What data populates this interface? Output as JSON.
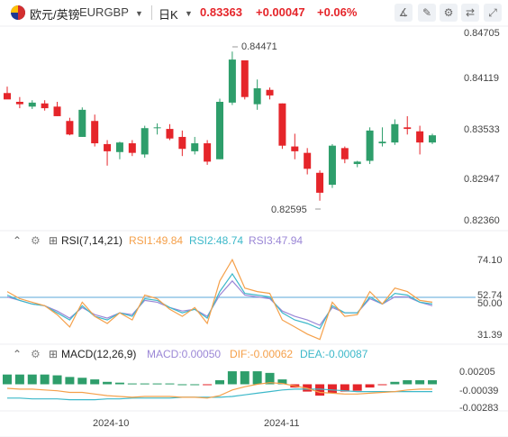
{
  "header": {
    "pair_name": "欧元/英镑",
    "symbol": "EURGBP",
    "period": "日K",
    "price": "0.83363",
    "change": "+0.00047",
    "change_pct": "+0.06%"
  },
  "price_axis": [
    "0.84705",
    "0.84119",
    "0.83533",
    "0.82947",
    "0.82360"
  ],
  "high_label": "0.84471",
  "low_label": "0.82595",
  "rsi": {
    "label": "RSI(7,14,21)",
    "rsi1": "RSI1:49.84",
    "rsi2": "RSI2:48.74",
    "rsi3": "RSI3:47.94",
    "axis": [
      "74.10",
      "52.74",
      "50.00",
      "31.39"
    ]
  },
  "macd": {
    "label": "MACD(12,26,9)",
    "macd": "MACD:0.00050",
    "dif": "DIF:-0.00062",
    "dea": "DEA:-0.00087",
    "axis": [
      "0.00205",
      "-0.00039",
      "-0.00283"
    ]
  },
  "dates": [
    "2024-10",
    "2024-11"
  ],
  "colors": {
    "up": "#2e9e6b",
    "down": "#e5252a",
    "rsi1": "#f5a04a",
    "rsi2": "#3cb8c9",
    "rsi3": "#9b87d6"
  },
  "icons": [
    "chart-type-icon",
    "drawing-tools-icon",
    "indicator-icon",
    "compare-icon",
    "fullscreen-icon"
  ],
  "chart_data": {
    "type": "candlestick",
    "candles": [
      {
        "o": 0.8395,
        "h": 0.8403,
        "l": 0.8388,
        "c": 0.8387
      },
      {
        "o": 0.8384,
        "h": 0.839,
        "l": 0.8376,
        "c": 0.8381
      },
      {
        "o": 0.8378,
        "h": 0.8386,
        "l": 0.8375,
        "c": 0.8383
      },
      {
        "o": 0.8382,
        "h": 0.8386,
        "l": 0.8373,
        "c": 0.8376
      },
      {
        "o": 0.8378,
        "h": 0.8384,
        "l": 0.8366,
        "c": 0.8366
      },
      {
        "o": 0.836,
        "h": 0.8364,
        "l": 0.8342,
        "c": 0.8343
      },
      {
        "o": 0.834,
        "h": 0.8377,
        "l": 0.834,
        "c": 0.8374
      },
      {
        "o": 0.836,
        "h": 0.8368,
        "l": 0.8328,
        "c": 0.8332
      },
      {
        "o": 0.8331,
        "h": 0.8336,
        "l": 0.8304,
        "c": 0.8322
      },
      {
        "o": 0.8321,
        "h": 0.8334,
        "l": 0.8312,
        "c": 0.8333
      },
      {
        "o": 0.8332,
        "h": 0.8336,
        "l": 0.8316,
        "c": 0.832
      },
      {
        "o": 0.8318,
        "h": 0.8354,
        "l": 0.8314,
        "c": 0.8351
      },
      {
        "o": 0.8351,
        "h": 0.8357,
        "l": 0.8343,
        "c": 0.8352
      },
      {
        "o": 0.835,
        "h": 0.8356,
        "l": 0.8336,
        "c": 0.8338
      },
      {
        "o": 0.834,
        "h": 0.8348,
        "l": 0.8316,
        "c": 0.8325
      },
      {
        "o": 0.8322,
        "h": 0.834,
        "l": 0.8318,
        "c": 0.8332
      },
      {
        "o": 0.8332,
        "h": 0.8336,
        "l": 0.8305,
        "c": 0.8309
      },
      {
        "o": 0.8312,
        "h": 0.8388,
        "l": 0.8312,
        "c": 0.8384
      },
      {
        "o": 0.8383,
        "h": 0.8447,
        "l": 0.838,
        "c": 0.8437
      },
      {
        "o": 0.8436,
        "h": 0.8436,
        "l": 0.8387,
        "c": 0.839
      },
      {
        "o": 0.8381,
        "h": 0.8412,
        "l": 0.8374,
        "c": 0.8401
      },
      {
        "o": 0.8399,
        "h": 0.8402,
        "l": 0.8387,
        "c": 0.8392
      },
      {
        "o": 0.8382,
        "h": 0.8382,
        "l": 0.8325,
        "c": 0.8329
      },
      {
        "o": 0.8328,
        "h": 0.8344,
        "l": 0.8312,
        "c": 0.8322
      },
      {
        "o": 0.832,
        "h": 0.8326,
        "l": 0.8293,
        "c": 0.83
      },
      {
        "o": 0.8295,
        "h": 0.8298,
        "l": 0.826,
        "c": 0.827
      },
      {
        "o": 0.828,
        "h": 0.8331,
        "l": 0.8276,
        "c": 0.8329
      },
      {
        "o": 0.8326,
        "h": 0.8328,
        "l": 0.8307,
        "c": 0.8312
      },
      {
        "o": 0.8306,
        "h": 0.831,
        "l": 0.8302,
        "c": 0.8309
      },
      {
        "o": 0.831,
        "h": 0.8352,
        "l": 0.8306,
        "c": 0.8348
      },
      {
        "o": 0.8332,
        "h": 0.8352,
        "l": 0.8328,
        "c": 0.8334
      },
      {
        "o": 0.8333,
        "h": 0.8362,
        "l": 0.833,
        "c": 0.8356
      },
      {
        "o": 0.8352,
        "h": 0.8366,
        "l": 0.8343,
        "c": 0.835
      },
      {
        "o": 0.8347,
        "h": 0.8354,
        "l": 0.8318,
        "c": 0.8333
      },
      {
        "o": 0.8333,
        "h": 0.8344,
        "l": 0.8331,
        "c": 0.8342
      }
    ],
    "rsi1": [
      56,
      52,
      50,
      48,
      43,
      36,
      50,
      42,
      38,
      44,
      40,
      54,
      52,
      46,
      42,
      47,
      38,
      62,
      74,
      58,
      56,
      55,
      40,
      36,
      32,
      29,
      50,
      42,
      43,
      56,
      49,
      58,
      56,
      51,
      50
    ],
    "rsi2": [
      54,
      51,
      49,
      48,
      44,
      40,
      48,
      42,
      40,
      44,
      42,
      52,
      51,
      47,
      44,
      46,
      41,
      56,
      66,
      55,
      54,
      53,
      44,
      40,
      38,
      35,
      48,
      44,
      44,
      53,
      49,
      55,
      54,
      50,
      49
    ],
    "rsi3": [
      53,
      51,
      49,
      48,
      45,
      41,
      47,
      43,
      41,
      44,
      43,
      51,
      50,
      47,
      45,
      46,
      42,
      54,
      62,
      54,
      53,
      52,
      45,
      42,
      40,
      37,
      47,
      44,
      44,
      52,
      49,
      53,
      53,
      50,
      48
    ],
    "macd_hist": [
      0.0012,
      0.0012,
      0.0012,
      0.0012,
      0.0011,
      0.0009,
      0.0008,
      0.0006,
      0.0003,
      0.0002,
      0.0001,
      0.0001,
      0.0001,
      0.0001,
      0.0,
      0.0,
      -0.0001,
      0.0005,
      0.0016,
      0.0016,
      0.0016,
      0.0014,
      0.0006,
      -0.0004,
      -0.0009,
      -0.0014,
      -0.0011,
      -0.0009,
      -0.0008,
      -0.0004,
      -0.0001,
      0.0003,
      0.0005,
      0.0005,
      0.0005
    ],
    "dif": [
      -0.0005,
      -0.0006,
      -0.0006,
      -0.0007,
      -0.0008,
      -0.001,
      -0.001,
      -0.0012,
      -0.0014,
      -0.0015,
      -0.0016,
      -0.0015,
      -0.0015,
      -0.0015,
      -0.0016,
      -0.0016,
      -0.0017,
      -0.0014,
      -0.0007,
      -0.0003,
      0.0,
      0.0002,
      0.0001,
      -0.0002,
      -0.0005,
      -0.001,
      -0.0011,
      -0.0012,
      -0.0012,
      -0.0011,
      -0.001,
      -0.0009,
      -0.0007,
      -0.0006,
      -0.0006
    ],
    "dea": [
      -0.0017,
      -0.0017,
      -0.0018,
      -0.0018,
      -0.0018,
      -0.0019,
      -0.0019,
      -0.0019,
      -0.0018,
      -0.0018,
      -0.0017,
      -0.0017,
      -0.0017,
      -0.0017,
      -0.0016,
      -0.0016,
      -0.0016,
      -0.0016,
      -0.0015,
      -0.0013,
      -0.0011,
      -0.0009,
      -0.0007,
      -0.0006,
      -0.0006,
      -0.0006,
      -0.0007,
      -0.0008,
      -0.0009,
      -0.0009,
      -0.0009,
      -0.0009,
      -0.0009,
      -0.0009,
      -0.0009
    ],
    "price_range": [
      0.8236,
      0.8471
    ],
    "rsi_range": [
      31.39,
      74.1
    ],
    "macd_range": [
      -0.00283,
      0.00205
    ]
  }
}
